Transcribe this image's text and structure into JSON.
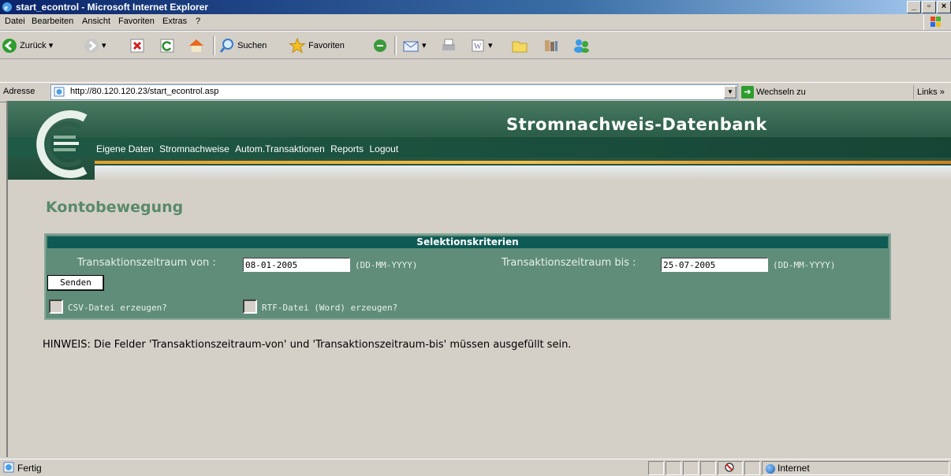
{
  "window": {
    "title": "start_econtrol - Microsoft Internet Explorer",
    "min": "_",
    "max": "▫",
    "close": "×"
  },
  "menu": {
    "items": [
      "Datei",
      "Bearbeiten",
      "Ansicht",
      "Favoriten",
      "Extras",
      "?"
    ]
  },
  "toolbar": {
    "back": "Zurück",
    "search": "Suchen",
    "favorites": "Favoriten"
  },
  "address": {
    "label": "Adresse",
    "url": "http://80.120.120.23/start_econtrol.asp",
    "go": "Wechseln zu",
    "links": "Links"
  },
  "banner": {
    "title": "Stromnachweis-Datenbank",
    "nav": [
      "Eigene Daten",
      "Stromnachweise",
      "Autom.Transaktionen",
      "Reports",
      "Logout"
    ]
  },
  "page": {
    "heading": "Kontobewegung",
    "panel_title": "Selektionskriterien",
    "from_label": "Transaktionszeitraum von :",
    "from_value": "08-01-2005",
    "from_format": "(DD-MM-YYYY)",
    "to_label": "Transaktionszeitraum bis :",
    "to_value": "25-07-2005",
    "to_format": "(DD-MM-YYYY)",
    "send_button": "Senden",
    "csv_label": "CSV-Datei erzeugen?",
    "rtf_label": "RTF-Datei (Word) erzeugen?",
    "hint": "HINWEIS: Die Felder 'Transaktionszeitraum-von' und 'Transaktionszeitraum-bis' müssen ausgefüllt sein."
  },
  "status": {
    "text": "Fertig",
    "zone": "Internet"
  },
  "colors": {
    "banner": "#2d5f4a",
    "panel": "#5f8d7a",
    "panel_header": "#0e5a55",
    "heading": "#5a8a6a"
  }
}
